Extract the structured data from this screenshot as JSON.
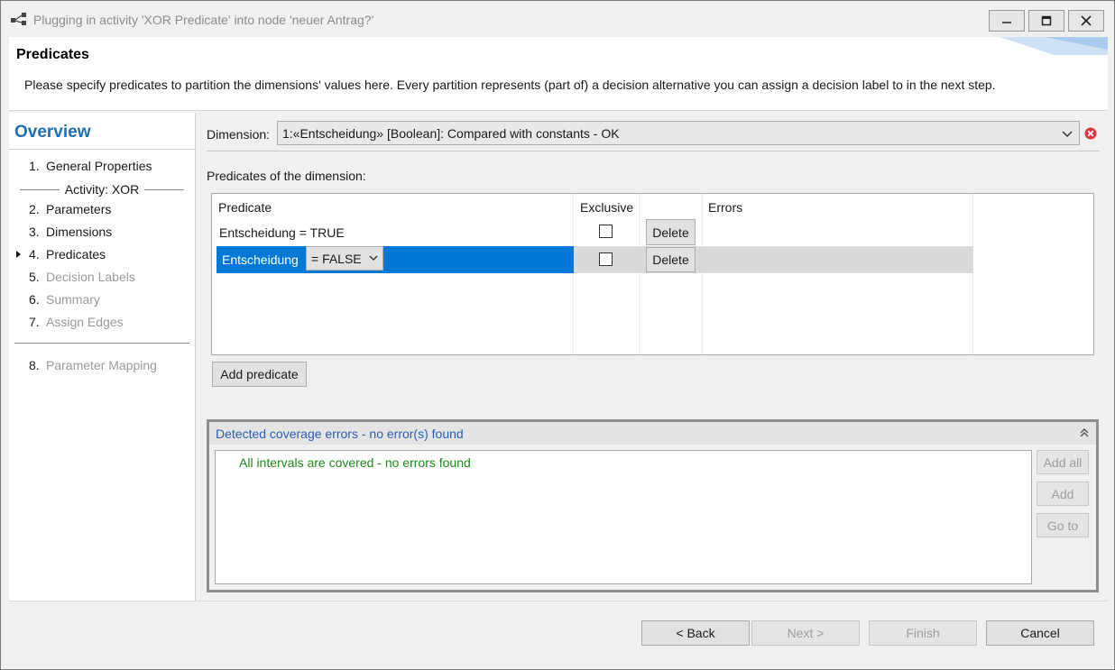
{
  "window": {
    "title": "Plugging in activity 'XOR Predicate' into node 'neuer Antrag?'"
  },
  "header": {
    "title": "Predicates",
    "description": "Please specify predicates to partition the dimensions' values here. Every partition represents (part of) a decision alternative you can assign a decision label to in the next step."
  },
  "nav": {
    "title": "Overview",
    "items": [
      {
        "num": "1.",
        "label": "General Properties",
        "enabled": true
      },
      {
        "num": "2.",
        "label": "Parameters",
        "enabled": true
      },
      {
        "num": "3.",
        "label": "Dimensions",
        "enabled": true
      },
      {
        "num": "4.",
        "label": "Predicates",
        "enabled": true,
        "current": true
      },
      {
        "num": "5.",
        "label": "Decision Labels",
        "enabled": false
      },
      {
        "num": "6.",
        "label": "Summary",
        "enabled": false
      },
      {
        "num": "7.",
        "label": "Assign Edges",
        "enabled": false
      },
      {
        "num": "8.",
        "label": "Parameter Mapping",
        "enabled": false
      }
    ],
    "group_label": "Activity: XOR"
  },
  "dimension": {
    "label": "Dimension:",
    "selected": "1:«Entscheidung» [Boolean]: Compared with constants  -  OK"
  },
  "predicates": {
    "section_label": "Predicates of the dimension:",
    "columns": [
      "Predicate",
      "Exclusive",
      "",
      "Errors"
    ],
    "rows": [
      {
        "variable": "Entscheidung",
        "operator": "= TRUE",
        "exclusive": false,
        "delete_label": "Delete",
        "errors": ""
      },
      {
        "variable": "Entscheidung",
        "operator": "= FALSE",
        "exclusive": false,
        "delete_label": "Delete",
        "errors": ""
      }
    ],
    "add_label": "Add predicate"
  },
  "coverage": {
    "title": "Detected coverage errors - no error(s) found",
    "message": "All intervals are covered - no errors found",
    "add_all_label": "Add all",
    "add_label": "Add",
    "goto_label": "Go to"
  },
  "footer": {
    "back_label": "< Back",
    "next_label": "Next >",
    "finish_label": "Finish",
    "cancel_label": "Cancel"
  },
  "colors": {
    "accent": "#0078d7",
    "nav_title": "#1f6fb5",
    "ok_text": "#1e8a1e",
    "error_icon": "#d9363e"
  }
}
